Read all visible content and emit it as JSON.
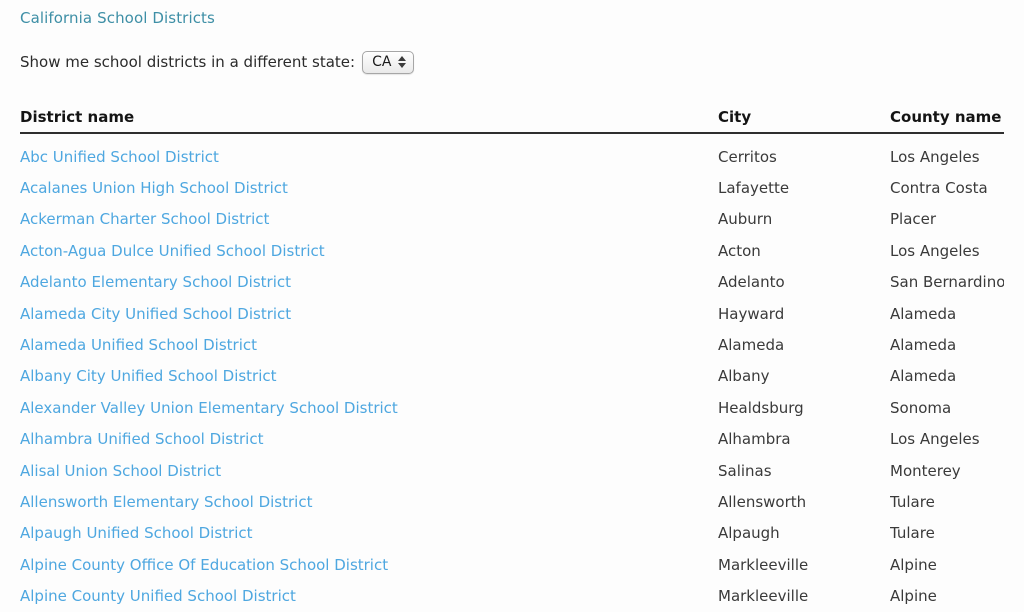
{
  "page": {
    "title": "California School Districts"
  },
  "state_form": {
    "label": "Show me school districts in a different state:",
    "selected_state": "CA",
    "stepper_up_icon": "triangle-up-icon",
    "stepper_down_icon": "triangle-down-icon"
  },
  "table": {
    "columns": [
      "District name",
      "City",
      "County name"
    ],
    "rows": [
      {
        "district": "Abc Unified School District",
        "city": "Cerritos",
        "county": "Los Angeles"
      },
      {
        "district": "Acalanes Union High School District",
        "city": "Lafayette",
        "county": "Contra Costa"
      },
      {
        "district": "Ackerman Charter School District",
        "city": "Auburn",
        "county": "Placer"
      },
      {
        "district": "Acton-Agua Dulce Unified School District",
        "city": "Acton",
        "county": "Los Angeles"
      },
      {
        "district": "Adelanto Elementary School District",
        "city": "Adelanto",
        "county": "San Bernardino"
      },
      {
        "district": "Alameda City Unified School District",
        "city": "Hayward",
        "county": "Alameda"
      },
      {
        "district": "Alameda Unified School District",
        "city": "Alameda",
        "county": "Alameda"
      },
      {
        "district": "Albany City Unified School District",
        "city": "Albany",
        "county": "Alameda"
      },
      {
        "district": "Alexander Valley Union Elementary School District",
        "city": "Healdsburg",
        "county": "Sonoma"
      },
      {
        "district": "Alhambra Unified School District",
        "city": "Alhambra",
        "county": "Los Angeles"
      },
      {
        "district": "Alisal Union School District",
        "city": "Salinas",
        "county": "Monterey"
      },
      {
        "district": "Allensworth Elementary School District",
        "city": "Allensworth",
        "county": "Tulare"
      },
      {
        "district": "Alpaugh Unified School District",
        "city": "Alpaugh",
        "county": "Tulare"
      },
      {
        "district": "Alpine County Office Of Education School District",
        "city": "Markleeville",
        "county": "Alpine"
      },
      {
        "district": "Alpine County Unified School District",
        "city": "Markleeville",
        "county": "Alpine"
      }
    ]
  },
  "colors": {
    "title": "#3e8fa6",
    "link": "#4ea7e0",
    "header_rule": "#2e2e2e",
    "background": "#fdfdfd"
  }
}
